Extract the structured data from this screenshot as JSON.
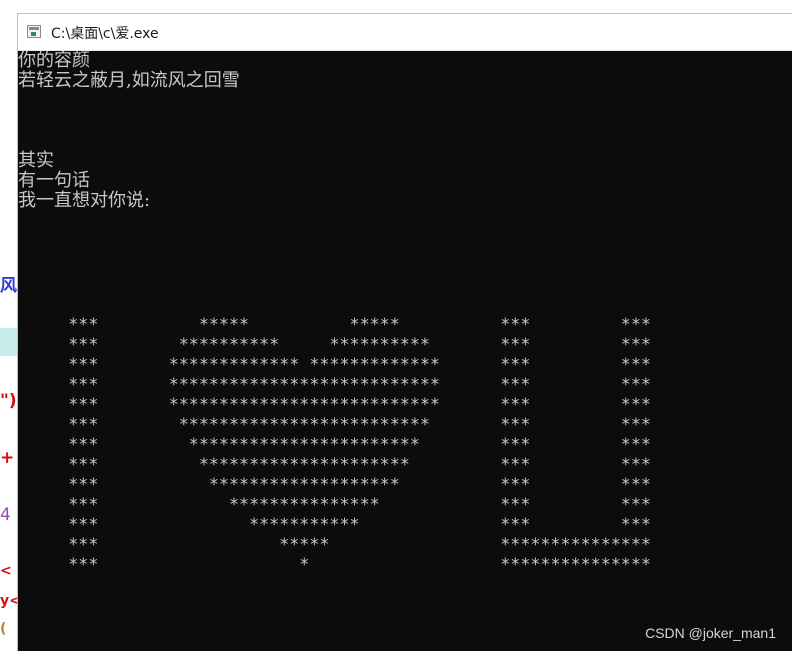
{
  "editor_behind": {
    "fragments": [
      "风",
      "\")",
      "+",
      "4 .",
      "<",
      "y<",
      "("
    ]
  },
  "window": {
    "title": "C:\\桌面\\c\\爱.exe",
    "icon": "console-app-icon"
  },
  "console": {
    "text_lines": [
      "你的容颜",
      "若轻云之蔽月,如流风之回雪",
      "",
      "",
      "",
      "其实",
      "有一句话",
      "我一直想对你说:"
    ],
    "art_rows": [
      "     ***          *****          *****          ***         ***",
      "     ***        **********     **********       ***         ***",
      "     ***       ************* *************      ***         ***",
      "     ***       ***************************      ***         ***",
      "     ***       ***************************      ***         ***",
      "     ***        *************************       ***         ***",
      "     ***         ***********************        ***         ***",
      "     ***          *********************         ***         ***",
      "     ***           *******************          ***         ***",
      "     ***             ***************            ***         ***",
      "     ***               ***********              ***         ***",
      "     ***                  *****                 ***************",
      "     ***                    *                   ***************"
    ]
  },
  "watermark": "CSDN @joker_man1",
  "colors": {
    "console_bg": "#0c0c0c",
    "console_fg": "#c8c8c8",
    "titlebar_bg": "#ffffff"
  }
}
